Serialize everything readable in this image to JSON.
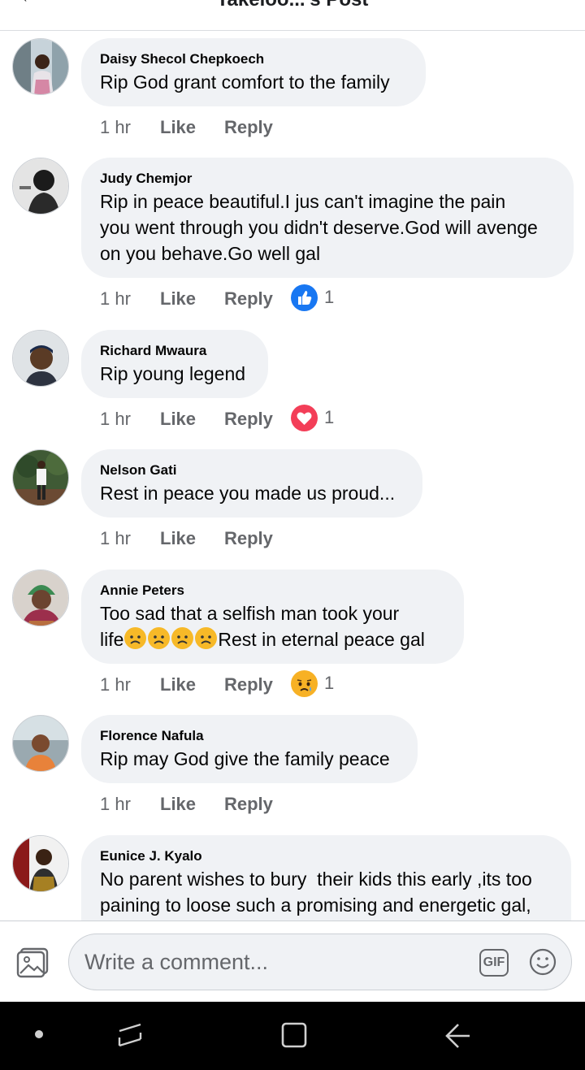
{
  "header": {
    "title": "Takeloo...'s Post"
  },
  "comments": [
    {
      "name": "Daisy Shecol Chepkoech",
      "text": "Rip God grant comfort to the family",
      "time": "1 hr",
      "like": "Like",
      "reply": "Reply",
      "reaction": null
    },
    {
      "name": "Judy Chemjor",
      "lines": [
        "Rip in peace beautiful.I jus can't imagine the pain",
        "you went through you didn't deserve.God will avenge",
        "on you behave.Go well gal"
      ],
      "time": "1 hr",
      "like": "Like",
      "reply": "Reply",
      "reaction": {
        "icon": "like-reaction-icon",
        "count": "1"
      }
    },
    {
      "name": "Richard Mwaura",
      "text": "Rip young legend",
      "time": "1 hr",
      "like": "Like",
      "reply": "Reply",
      "reaction": {
        "icon": "love-reaction-icon",
        "count": "1"
      }
    },
    {
      "name": "Nelson Gati",
      "text": "Rest in peace you made us proud...",
      "time": "1 hr",
      "like": "Like",
      "reply": "Reply",
      "reaction": null
    },
    {
      "name": "Annie Peters",
      "line1": "Too sad that a selfish man took your",
      "line2_prefix": "life",
      "line2_suffix": "Rest in eternal peace gal",
      "time": "1 hr",
      "like": "Like",
      "reply": "Reply",
      "reaction": {
        "icon": "sad-reaction-icon",
        "count": "1"
      }
    },
    {
      "name": "Florence Nafula",
      "text": "Rip may God give the family peace",
      "time": "1 hr",
      "like": "Like",
      "reply": "Reply",
      "reaction": null
    },
    {
      "name": "Eunice J. Kyalo",
      "lines": [
        "No parent wishes to bury  their kids this early ,its too",
        "paining to loose such a promising and energetic gal,"
      ]
    }
  ],
  "composer": {
    "placeholder": "Write a comment...",
    "gif_label": "GIF"
  },
  "colors": {
    "bubble": "#f0f2f5",
    "like": "#1877f2",
    "love": "#f33e58",
    "sad": "#f7b125",
    "meta": "#65676b"
  }
}
